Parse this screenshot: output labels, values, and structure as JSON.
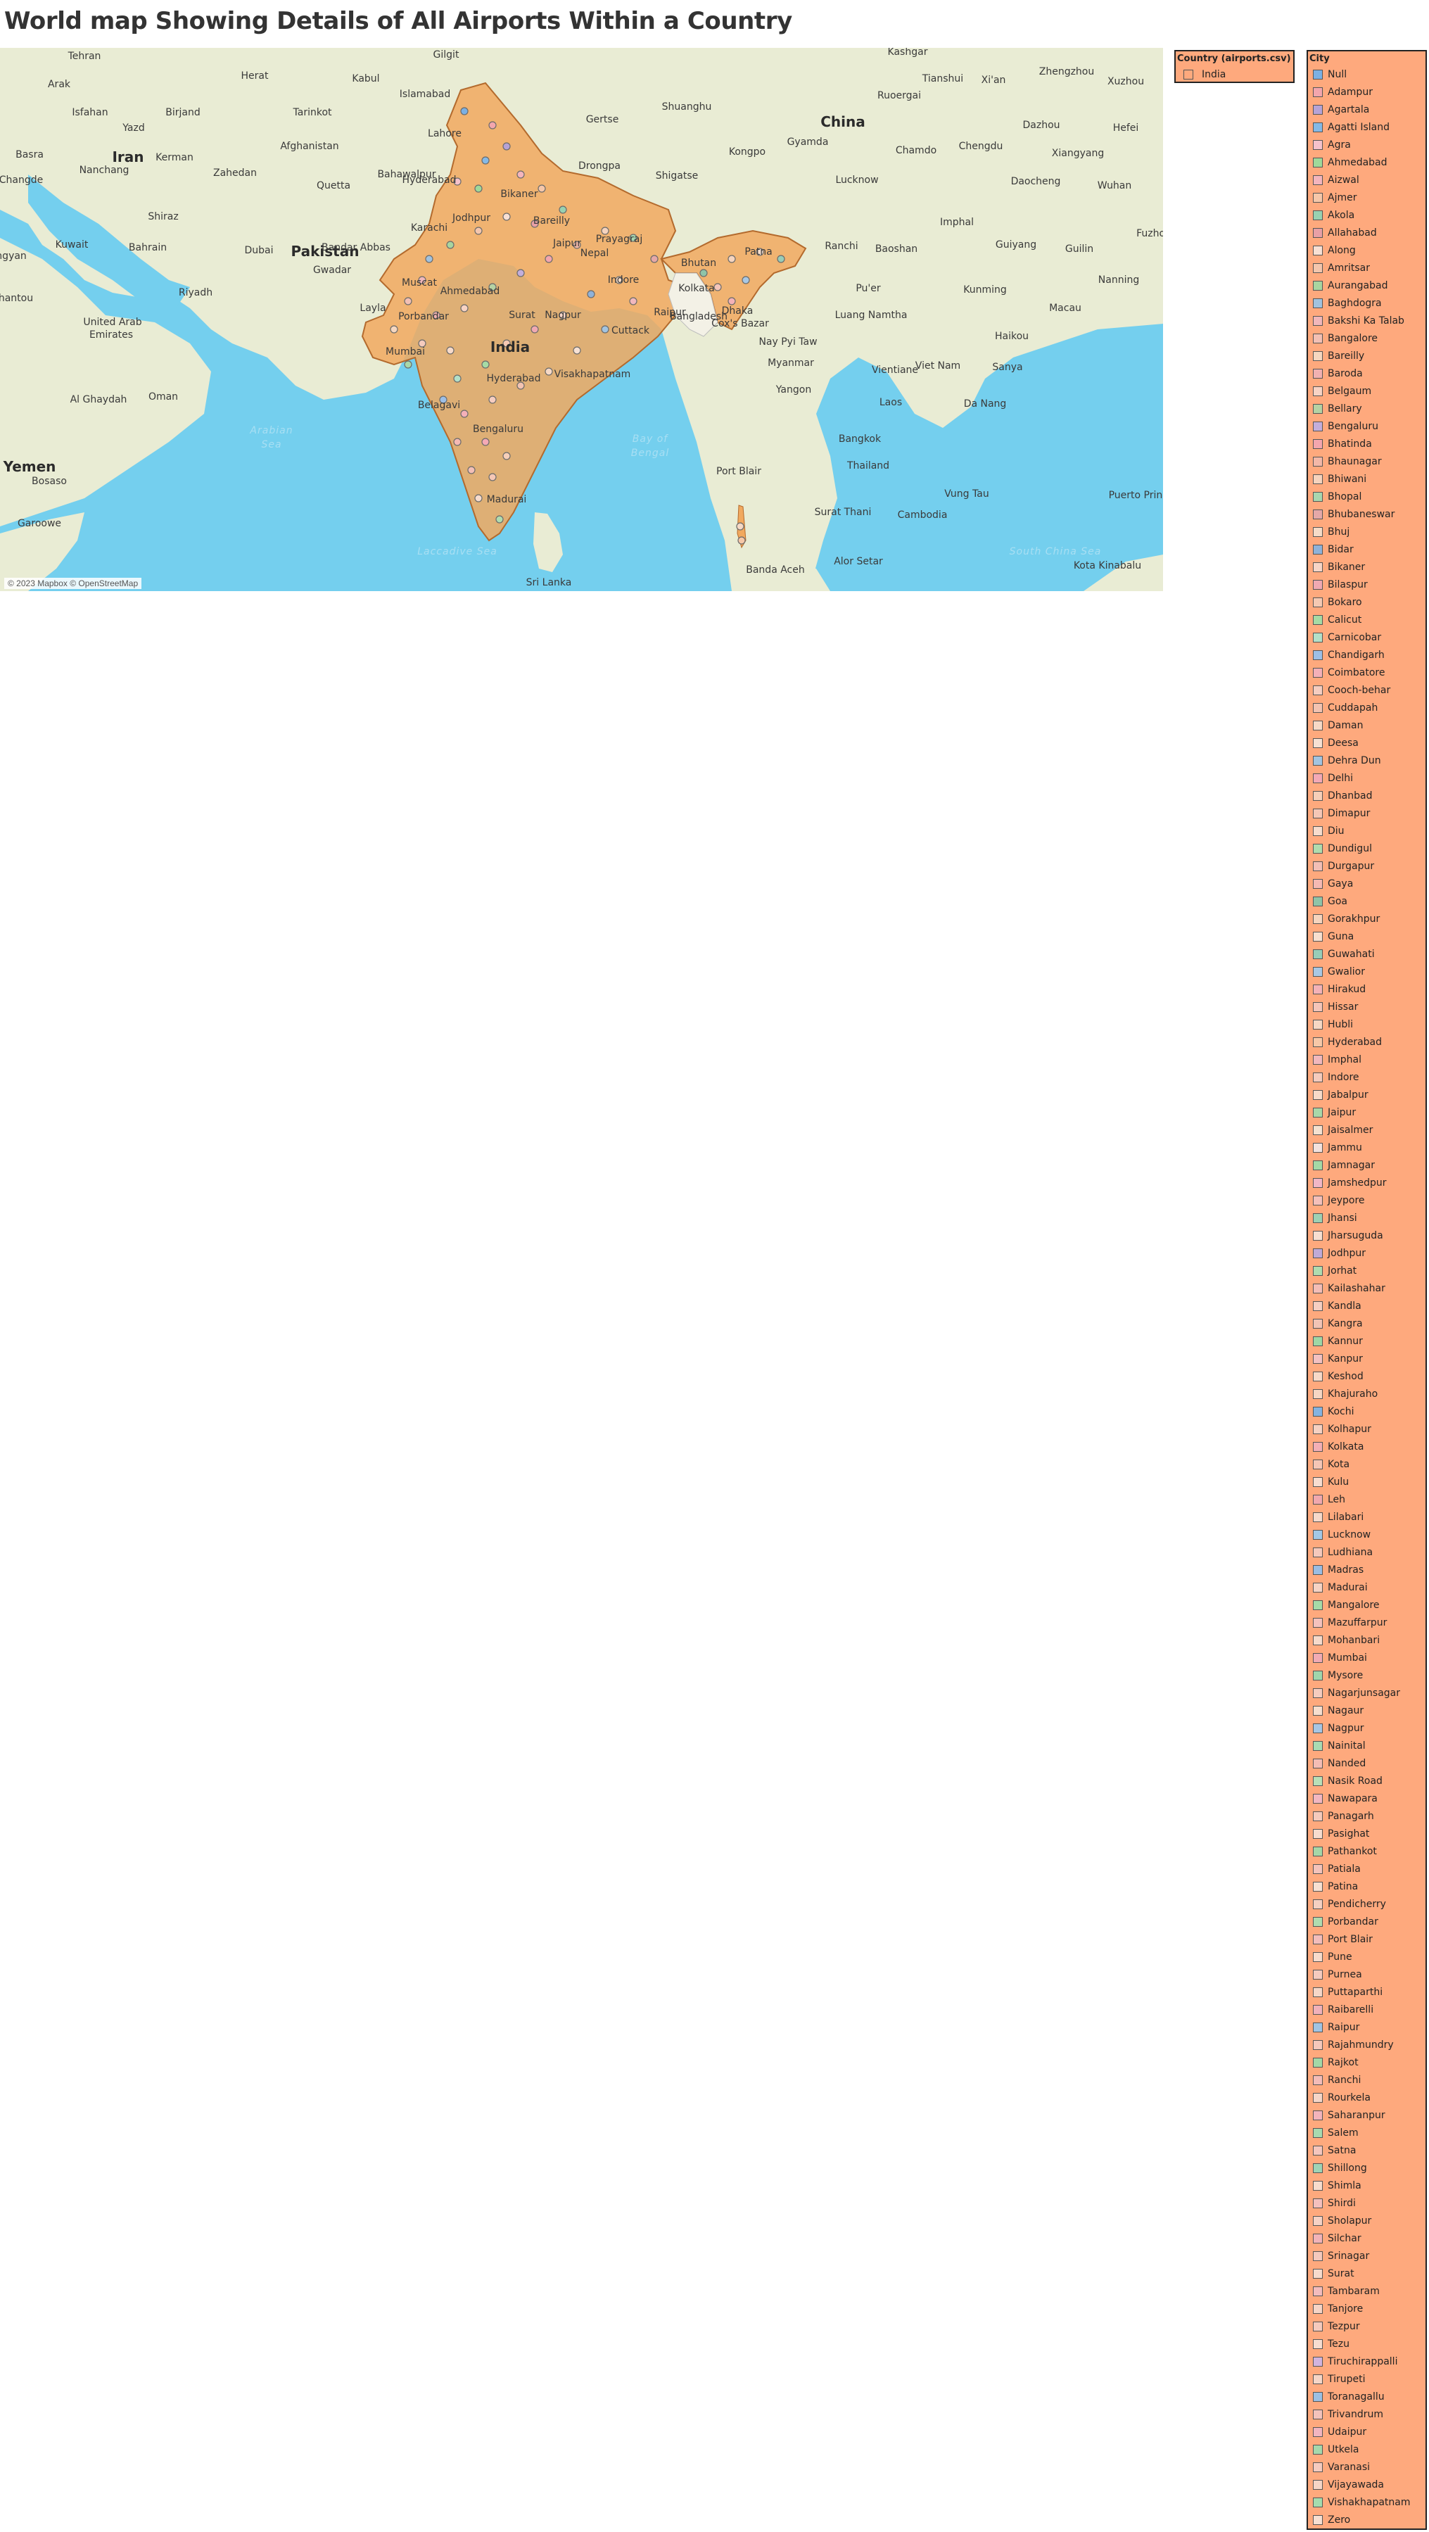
{
  "title": "World map Showing Details of All Airports Within a Country",
  "map": {
    "attribution": "© 2023 Mapbox © OpenStreetMap",
    "colors": {
      "water": "#74cfee",
      "land": "#e9ecd4",
      "country_fill": "#f1a95f",
      "country_stroke": "#b36a2d"
    },
    "country_labels": [
      {
        "text": "India",
        "cls": "c"
      },
      {
        "text": "Pakistan",
        "cls": "c"
      },
      {
        "text": "China",
        "cls": "c"
      },
      {
        "text": "Iran",
        "cls": "c"
      },
      {
        "text": "Yemen",
        "cls": "c"
      },
      {
        "text": "Nepal",
        "cls": "city"
      },
      {
        "text": "Bhutan",
        "cls": "city"
      },
      {
        "text": "Bangladesh",
        "cls": "city"
      },
      {
        "text": "Myanmar",
        "cls": "city"
      },
      {
        "text": "Thailand",
        "cls": "city"
      },
      {
        "text": "Laos",
        "cls": "city"
      },
      {
        "text": "Viet Nam",
        "cls": "city"
      },
      {
        "text": "Cambodia",
        "cls": "city"
      },
      {
        "text": "Oman",
        "cls": "city"
      },
      {
        "text": "Afghanistan",
        "cls": "city"
      },
      {
        "text": "Sri Lanka",
        "cls": "city"
      },
      {
        "text": "United Arab",
        "cls": "city"
      },
      {
        "text": "Emirates",
        "cls": "city"
      }
    ],
    "city_labels": [
      "Tehran",
      "Gilgit",
      "Kabul",
      "Herat",
      "Islamabad",
      "Lahore",
      "Kashgar",
      "Tianshui",
      "Xi'an",
      "Zhengzhou",
      "Xuzhou",
      "Arak",
      "Isfahan",
      "Yazd",
      "Birjand",
      "Tarinkot",
      "Gertse",
      "Shuanghu",
      "Ruoergai",
      "Hefei",
      "Basra",
      "Kerman",
      "Quetta",
      "Zahedan",
      "Bahawalpur",
      "Drongpa",
      "Shigatse",
      "Kongpo",
      "Gyamda",
      "Chamdo",
      "Chengdu",
      "Dazhou",
      "Xiangyang",
      "Wuhan",
      "Nanchang",
      "Shiraz",
      "Bandar Abbas",
      "Hyderabad",
      "Bikaner",
      "Bareilly",
      "Lucknow",
      "Daocheng",
      "Changde",
      "Kuwait",
      "Bahrain",
      "Dubai",
      "Gwadar",
      "Karachi",
      "Jodhpur",
      "Jaipur",
      "Prayagraj",
      "Patna",
      "Imphal",
      "Guiyang",
      "Guilin",
      "Longyan",
      "Riyadh",
      "Muscat",
      "Ahmedabad",
      "Indore",
      "Ranchi",
      "Baoshan",
      "Kunming",
      "Nanning",
      "Shantou",
      "Layla",
      "Porbandar",
      "Surat",
      "Nagpur",
      "Raipur",
      "Kolkata",
      "Dhaka",
      "Pu'er",
      "Macau",
      "Mumbai",
      "Cuttack",
      "Cox's Bazar",
      "Nay Pyi Taw",
      "Luang Namtha",
      "Haikou",
      "Hyderabad",
      "Visakhapatnam",
      "Yangon",
      "Vientiane",
      "Sanya",
      "Al Ghaydah",
      "Belagavi",
      "Bengaluru",
      "Bangkok",
      "Da Nang",
      "Bosaso",
      "Madurai",
      "Port Blair",
      "Surat Thani",
      "Vung Tau",
      "Garoowe",
      "Banda Aceh",
      "Alor Setar",
      "Kota Kinabalu",
      "Puerto Princesa",
      "Fuzhou"
    ],
    "sea_labels": [
      "Arabian",
      "Sea",
      "Bay of",
      "Bengal",
      "Laccadive Sea",
      "South China Sea"
    ]
  },
  "country_legend": {
    "title": "Country (airports.csv)",
    "items": [
      {
        "label": "India",
        "color": "#fea97d"
      }
    ]
  },
  "city_legend": {
    "title": "City",
    "items": [
      {
        "label": "Null",
        "color": "#7bb0e3"
      },
      {
        "label": "Adampur",
        "color": "#f3a6ad"
      },
      {
        "label": "Agartala",
        "color": "#b6a3d6"
      },
      {
        "label": "Agatti Island",
        "color": "#85b9e6"
      },
      {
        "label": "Agra",
        "color": "#f5c2cb"
      },
      {
        "label": "Ahmedabad",
        "color": "#9fd99a"
      },
      {
        "label": "Aizwal",
        "color": "#f4b5bd"
      },
      {
        "label": "Ajmer",
        "color": "#f6c7a9"
      },
      {
        "label": "Akola",
        "color": "#98d1b1"
      },
      {
        "label": "Allahabad",
        "color": "#e8a0a6"
      },
      {
        "label": "Along",
        "color": "#f8e0d4"
      },
      {
        "label": "Amritsar",
        "color": "#f4c6ad"
      },
      {
        "label": "Aurangabad",
        "color": "#a8d5a0"
      },
      {
        "label": "Baghdogra",
        "color": "#a1c2de"
      },
      {
        "label": "Bakshi Ka Talab",
        "color": "#f1b7ba"
      },
      {
        "label": "Bangalore",
        "color": "#f3c0b4"
      },
      {
        "label": "Bareilly",
        "color": "#f6d7c0"
      },
      {
        "label": "Baroda",
        "color": "#f1b1b1"
      },
      {
        "label": "Belgaum",
        "color": "#f8d3c4"
      },
      {
        "label": "Bellary",
        "color": "#b5d2a4"
      },
      {
        "label": "Bengaluru",
        "color": "#c3aedb"
      },
      {
        "label": "Bhatinda",
        "color": "#f4a6ae"
      },
      {
        "label": "Bhaunagar",
        "color": "#f3b8a8"
      },
      {
        "label": "Bhiwani",
        "color": "#f6d3bd"
      },
      {
        "label": "Bhopal",
        "color": "#a8d7b0"
      },
      {
        "label": "Bhubaneswar",
        "color": "#e5a8a8"
      },
      {
        "label": "Bhuj",
        "color": "#f6dcc8"
      },
      {
        "label": "Bidar",
        "color": "#8fb2d9"
      },
      {
        "label": "Bikaner",
        "color": "#f7d5c7"
      },
      {
        "label": "Bilaspur",
        "color": "#f0a9b2"
      },
      {
        "label": "Bokaro",
        "color": "#f5c9b3"
      },
      {
        "label": "Calicut",
        "color": "#a6dba5"
      },
      {
        "label": "Carnicobar",
        "color": "#b3e0c9"
      },
      {
        "label": "Chandigarh",
        "color": "#9dbfe6"
      },
      {
        "label": "Coimbatore",
        "color": "#f4b0b8"
      },
      {
        "label": "Cooch-behar",
        "color": "#f6cdc0"
      },
      {
        "label": "Cuddapah",
        "color": "#f3c3b1"
      },
      {
        "label": "Daman",
        "color": "#f6d9c6"
      },
      {
        "label": "Deesa",
        "color": "#f7e1d3"
      },
      {
        "label": "Dehra Dun",
        "color": "#a3c4e0"
      },
      {
        "label": "Delhi",
        "color": "#f4a9b5"
      },
      {
        "label": "Dhanbad",
        "color": "#f6cfb9"
      },
      {
        "label": "Dimapur",
        "color": "#f5c7b6"
      },
      {
        "label": "Diu",
        "color": "#f7dccd"
      },
      {
        "label": "Dundigul",
        "color": "#b0dcae"
      },
      {
        "label": "Durgapur",
        "color": "#f3bfb6"
      },
      {
        "label": "Gaya",
        "color": "#f5b9b3"
      },
      {
        "label": "Goa",
        "color": "#8fc4a8"
      },
      {
        "label": "Gorakhpur",
        "color": "#f6d4be"
      },
      {
        "label": "Guna",
        "color": "#f7dfcf"
      },
      {
        "label": "Guwahati",
        "color": "#98cdb8"
      },
      {
        "label": "Gwalior",
        "color": "#a9c8e4"
      },
      {
        "label": "Hirakud",
        "color": "#f4b2b7"
      },
      {
        "label": "Hissar",
        "color": "#f5c5b9"
      },
      {
        "label": "Hubli",
        "color": "#f6d8c4"
      },
      {
        "label": "Hyderabad",
        "color": "#f7c8a8"
      },
      {
        "label": "Imphal",
        "color": "#f2b8bd"
      },
      {
        "label": "Indore",
        "color": "#f5cbbd"
      },
      {
        "label": "Jabalpur",
        "color": "#f7dac9"
      },
      {
        "label": "Jaipur",
        "color": "#a9d8a9"
      },
      {
        "label": "Jaisalmer",
        "color": "#f5e1d0"
      },
      {
        "label": "Jammu",
        "color": "#f3e2de"
      },
      {
        "label": "Jamnagar",
        "color": "#a4d9a6"
      },
      {
        "label": "Jamshedpur",
        "color": "#f1b7c6"
      },
      {
        "label": "Jeypore",
        "color": "#f4c0ba"
      },
      {
        "label": "Jhansi",
        "color": "#9ed1b4"
      },
      {
        "label": "Jharsuguda",
        "color": "#f7dfd1"
      },
      {
        "label": "Jodhpur",
        "color": "#c0aad7"
      },
      {
        "label": "Jorhat",
        "color": "#b0dcb0"
      },
      {
        "label": "Kailashahar",
        "color": "#f4bdb6"
      },
      {
        "label": "Kandla",
        "color": "#f6cfc2"
      },
      {
        "label": "Kangra",
        "color": "#f2c4b5"
      },
      {
        "label": "Kannur",
        "color": "#9ed7a6"
      },
      {
        "label": "Kanpur",
        "color": "#f4c1c1"
      },
      {
        "label": "Keshod",
        "color": "#f7d9c8"
      },
      {
        "label": "Khajuraho",
        "color": "#f6d6c3"
      },
      {
        "label": "Kochi",
        "color": "#86b3e0"
      },
      {
        "label": "Kolhapur",
        "color": "#f6d1c2"
      },
      {
        "label": "Kolkata",
        "color": "#f3afb5"
      },
      {
        "label": "Kota",
        "color": "#f5c6b6"
      },
      {
        "label": "Kulu",
        "color": "#f8ddd0"
      },
      {
        "label": "Leh",
        "color": "#f1a8ae"
      },
      {
        "label": "Lilabari",
        "color": "#f6d9cb"
      },
      {
        "label": "Lucknow",
        "color": "#a3c8e6"
      },
      {
        "label": "Ludhiana",
        "color": "#f5c9bc"
      },
      {
        "label": "Madras",
        "color": "#9bbde3"
      },
      {
        "label": "Madurai",
        "color": "#f6d3c4"
      },
      {
        "label": "Mangalore",
        "color": "#a6dba8"
      },
      {
        "label": "Mazuffarpur",
        "color": "#f4c2bd"
      },
      {
        "label": "Mohanbari",
        "color": "#f6dacb"
      },
      {
        "label": "Mumbai",
        "color": "#f2abb4"
      },
      {
        "label": "Mysore",
        "color": "#9fd6ac"
      },
      {
        "label": "Nagarjunsagar",
        "color": "#f5ccbf"
      },
      {
        "label": "Nagaur",
        "color": "#f7dece"
      },
      {
        "label": "Nagpur",
        "color": "#a7c6e4"
      },
      {
        "label": "Nainital",
        "color": "#a8dbb3"
      },
      {
        "label": "Nanded",
        "color": "#f4bdb5"
      },
      {
        "label": "Nasik Road",
        "color": "#b9e0b8"
      },
      {
        "label": "Nawapara",
        "color": "#f3b7c1"
      },
      {
        "label": "Panagarh",
        "color": "#f5cabc"
      },
      {
        "label": "Pasighat",
        "color": "#f7dccf"
      },
      {
        "label": "Pathankot",
        "color": "#a6d7a8"
      },
      {
        "label": "Patiala",
        "color": "#f4c3bb"
      },
      {
        "label": "Patina",
        "color": "#f7e0d2"
      },
      {
        "label": "Pendicherry",
        "color": "#f5d0c2"
      },
      {
        "label": "Porbandar",
        "color": "#b0dcb0"
      },
      {
        "label": "Port Blair",
        "color": "#f3bdbb"
      },
      {
        "label": "Pune",
        "color": "#f7dbcc"
      },
      {
        "label": "Purnea",
        "color": "#f5cbbf"
      },
      {
        "label": "Puttaparthi",
        "color": "#f6d7c8"
      },
      {
        "label": "Raibarelli",
        "color": "#f1b1ba"
      },
      {
        "label": "Raipur",
        "color": "#a1c4e4"
      },
      {
        "label": "Rajahmundry",
        "color": "#f5c8bb"
      },
      {
        "label": "Rajkot",
        "color": "#a3d8a7"
      },
      {
        "label": "Ranchi",
        "color": "#f4bcb8"
      },
      {
        "label": "Rourkela",
        "color": "#f6d6c8"
      },
      {
        "label": "Saharanpur",
        "color": "#f3b4bc"
      },
      {
        "label": "Salem",
        "color": "#a8dab0"
      },
      {
        "label": "Satna",
        "color": "#f5c6bd"
      },
      {
        "label": "Shillong",
        "color": "#9fd4b6"
      },
      {
        "label": "Shimla",
        "color": "#f7dccd"
      },
      {
        "label": "Shirdi",
        "color": "#f4c0bd"
      },
      {
        "label": "Sholapur",
        "color": "#f6d2c5"
      },
      {
        "label": "Silchar",
        "color": "#f2b3b8"
      },
      {
        "label": "Srinagar",
        "color": "#f5c9bd"
      },
      {
        "label": "Surat",
        "color": "#f7dbcd"
      },
      {
        "label": "Tambaram",
        "color": "#f3bcbd"
      },
      {
        "label": "Tanjore",
        "color": "#f6d4c6"
      },
      {
        "label": "Tezpur",
        "color": "#f5cabd"
      },
      {
        "label": "Tezu",
        "color": "#f7ddd0"
      },
      {
        "label": "Tiruchirappalli",
        "color": "#d2b4de"
      },
      {
        "label": "Tirupeti",
        "color": "#f6d6c7"
      },
      {
        "label": "Toranagallu",
        "color": "#9cc0e4"
      },
      {
        "label": "Trivandrum",
        "color": "#f4c3bc"
      },
      {
        "label": "Udaipur",
        "color": "#f2b5c0"
      },
      {
        "label": "Utkela",
        "color": "#a6d8ac"
      },
      {
        "label": "Varanasi",
        "color": "#f5cbbf"
      },
      {
        "label": "Vijayawada",
        "color": "#f6d5c6"
      },
      {
        "label": "Vishakhapatnam",
        "color": "#a5dcae"
      },
      {
        "label": "Zero",
        "color": "#f7dfd2"
      }
    ]
  }
}
